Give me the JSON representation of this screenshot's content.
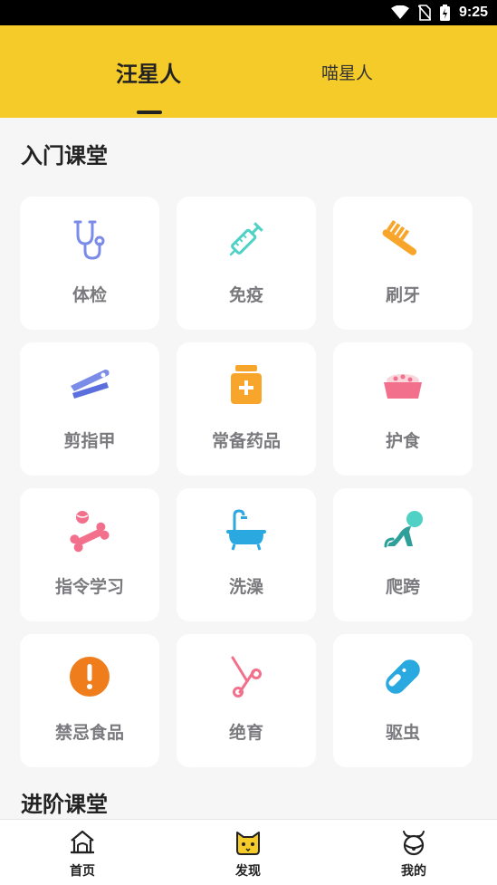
{
  "status_bar": {
    "time": "9:25",
    "icons": [
      "wifi-icon",
      "no-sim-icon",
      "battery-charging-icon"
    ]
  },
  "header": {
    "tabs": [
      {
        "label": "汪星人",
        "active": true
      },
      {
        "label": "喵星人",
        "active": false
      }
    ],
    "accent_color": "#f5cb2a"
  },
  "sections": {
    "intro_title": "入门课堂",
    "advanced_title": "进阶课堂"
  },
  "courses": [
    {
      "label": "体检",
      "icon": "stethoscope-icon"
    },
    {
      "label": "免疫",
      "icon": "syringe-icon"
    },
    {
      "label": "刷牙",
      "icon": "toothbrush-icon"
    },
    {
      "label": "剪指甲",
      "icon": "nail-clipper-icon"
    },
    {
      "label": "常备药品",
      "icon": "medicine-kit-icon"
    },
    {
      "label": "护食",
      "icon": "food-bowl-icon"
    },
    {
      "label": "指令学习",
      "icon": "bone-ball-icon"
    },
    {
      "label": "洗澡",
      "icon": "bathtub-icon"
    },
    {
      "label": "爬跨",
      "icon": "mounting-icon"
    },
    {
      "label": "禁忌食品",
      "icon": "warning-icon"
    },
    {
      "label": "绝育",
      "icon": "scissors-icon"
    },
    {
      "label": "驱虫",
      "icon": "pill-icon"
    }
  ],
  "bottom_nav": [
    {
      "label": "首页",
      "icon": "home-icon"
    },
    {
      "label": "发现",
      "icon": "cat-face-icon"
    },
    {
      "label": "我的",
      "icon": "profile-icon"
    }
  ]
}
